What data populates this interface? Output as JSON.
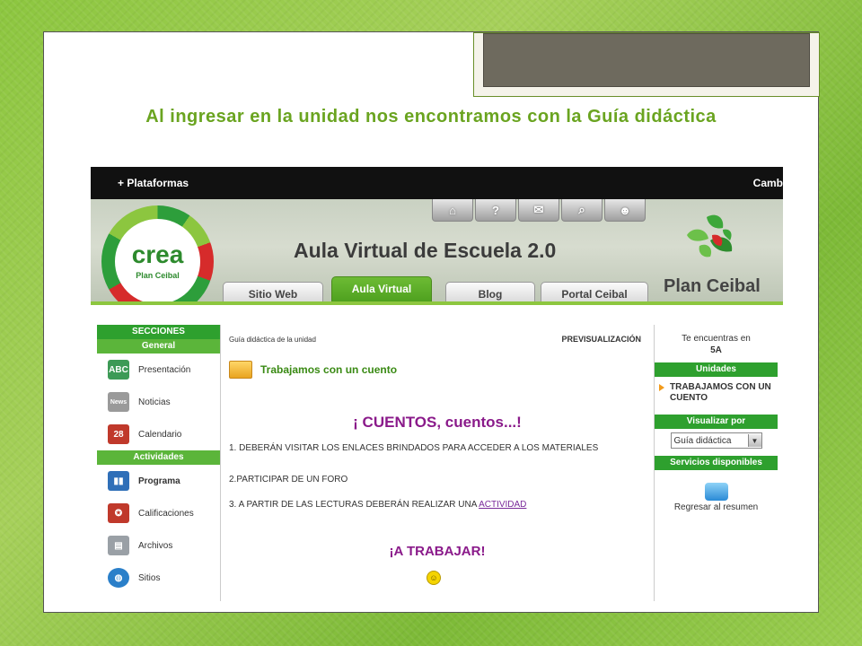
{
  "slide": {
    "title": "Al ingresar en la unidad nos encontramos con la Guía didáctica"
  },
  "topbar": {
    "platforms_label": "+ Plataformas",
    "right_label": "Camb"
  },
  "banner": {
    "crea_logo_text": "crea",
    "crea_logo_subtext": "Plan Ceibal",
    "site_title": "Aula Virtual de Escuela 2.0",
    "plan_ceibal_logo_text": "Plan Ceibal",
    "toolbar_icons": [
      "home-icon",
      "help-icon",
      "inbox-icon",
      "search-icon",
      "user-icon"
    ],
    "toolbar_glyphs": [
      "⌂",
      "?",
      "✉",
      "⌕",
      "☻"
    ],
    "tabs": [
      {
        "label": "Sitio Web",
        "active": false
      },
      {
        "label": "Aula Virtual",
        "active": true
      },
      {
        "label": "Blog",
        "active": false
      },
      {
        "label": "Portal Ceibal",
        "active": false
      }
    ]
  },
  "left_nav": {
    "sections_header": "SECCIONES",
    "general_header": "General",
    "general_items": [
      {
        "label": "Presentación",
        "icon": "presentation-icon",
        "glyph": "ABC",
        "color": "#3d9a56"
      },
      {
        "label": "Noticias",
        "icon": "news-icon",
        "glyph": "News",
        "color": "#9a9a9a"
      },
      {
        "label": "Calendario",
        "icon": "calendar-icon",
        "glyph": "28",
        "color": "#c0392b"
      }
    ],
    "activities_header": "Actividades",
    "activity_items": [
      {
        "label": "Programa",
        "icon": "binders-icon",
        "glyph": "▮▮",
        "color": "#2f6fb8",
        "bold": true
      },
      {
        "label": "Calificaciones",
        "icon": "award-icon",
        "glyph": "✪",
        "color": "#c0392b",
        "bold": false
      },
      {
        "label": "Archivos",
        "icon": "file-icon",
        "glyph": "▤",
        "color": "#9aa0a6",
        "bold": false
      },
      {
        "label": "Sitios",
        "icon": "globe-icon",
        "glyph": "◍",
        "color": "#2a7fc9",
        "bold": false
      }
    ]
  },
  "main": {
    "breadcrumb": "Guía didáctica de la unidad",
    "preview_label": "PREVISUALIZACIÓN",
    "unit_title": "Trabajamos con un cuento",
    "heading": "¡ CUENTOS, cuentos...!",
    "line1": "1. DEBERÁN VISITAR LOS ENLACES BRINDADOS PARA ACCEDER A LOS MATERIALES",
    "line2": "2.PARTICIPAR DE UN FORO",
    "line3_text": "3. A PARTIR DE LAS LECTURAS DEBERÁN REALIZAR UNA ",
    "line3_link": "ACTIVIDAD",
    "closing": "¡A TRABAJAR!",
    "smiley": "☺"
  },
  "right_col": {
    "location_label": "Te encuentras en",
    "location_value": "5A",
    "units_header": "Unidades",
    "unit_item": "TRABAJAMOS CON UN CUENTO",
    "view_header": "Visualizar por",
    "view_selected": "Guía didáctica",
    "services_header": "Servicios disponibles",
    "return_label": "Regresar al resumen"
  }
}
